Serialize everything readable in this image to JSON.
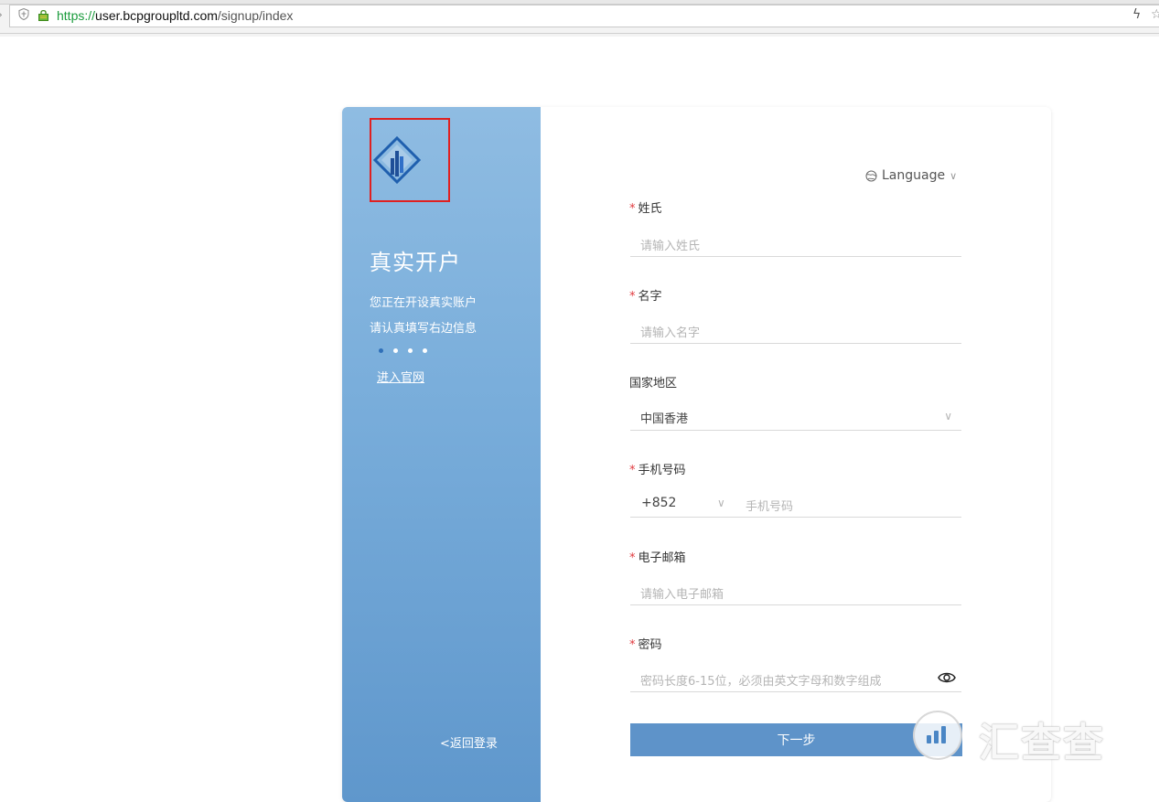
{
  "browser": {
    "url_scheme": "https://",
    "url_host": "user.bcpgroupltd.com",
    "url_path": "/signup/index"
  },
  "sidebar": {
    "title": "真实开户",
    "subtitle_line1": "您正在开设真实账户",
    "subtitle_line2": "请认真填写右边信息",
    "site_link": "进入官网",
    "back_link": "<返回登录"
  },
  "language_selector": {
    "label": "Language"
  },
  "form": {
    "surname": {
      "label": "姓氏",
      "required": true,
      "placeholder": "请输入姓氏"
    },
    "given_name": {
      "label": "名字",
      "required": true,
      "placeholder": "请输入名字"
    },
    "country": {
      "label": "国家地区",
      "required": false,
      "value": "中国香港"
    },
    "phone": {
      "label": "手机号码",
      "required": true,
      "country_code": "+852",
      "placeholder": "手机号码"
    },
    "email": {
      "label": "电子邮箱",
      "required": true,
      "placeholder": "请输入电子邮箱"
    },
    "password": {
      "label": "密码",
      "required": true,
      "placeholder": "密码长度6-15位，必须由英文字母和数字组成"
    },
    "required_mark": "*",
    "next_button": "下一步"
  },
  "watermark": {
    "text": "汇查查"
  },
  "colors": {
    "primary_button": "#5e93c9",
    "sidebar_top": "#8fbce2",
    "sidebar_bottom": "#5f97cc",
    "required_star": "#e0393e",
    "highlight_box": "#e02020"
  }
}
